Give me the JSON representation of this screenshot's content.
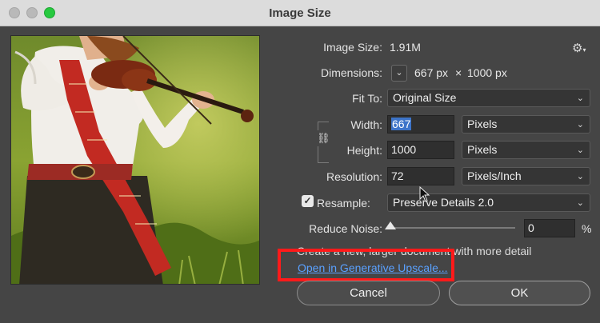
{
  "window": {
    "title": "Image Size"
  },
  "image_size": {
    "label": "Image Size:",
    "value": "1.91M"
  },
  "dimensions": {
    "label": "Dimensions:",
    "width": "667 px",
    "times": "×",
    "height": "1000 px"
  },
  "fit_to": {
    "label": "Fit To:",
    "selected": "Original Size"
  },
  "width": {
    "label": "Width:",
    "value": "667",
    "unit": "Pixels"
  },
  "height": {
    "label": "Height:",
    "value": "1000",
    "unit": "Pixels"
  },
  "resolution": {
    "label": "Resolution:",
    "value": "72",
    "unit": "Pixels/Inch"
  },
  "resample": {
    "label": "Resample:",
    "checked": true,
    "selected": "Preserve Details 2.0"
  },
  "reduce_noise": {
    "label": "Reduce Noise:",
    "value": "0",
    "unit": "%",
    "level": 0
  },
  "generative": {
    "info": "Create a new, larger document with more detail",
    "link": "Open in Generative Upscale..."
  },
  "buttons": {
    "cancel": "Cancel",
    "ok": "OK"
  },
  "icons": {
    "settings": "gear-icon",
    "link": "chain-link-icon",
    "dropdown": "chevron-down-icon"
  },
  "colors": {
    "dialog_bg": "#454545",
    "link": "#5aa1ff",
    "highlight_box": "#ff1a1a",
    "selection": "#3d74c9",
    "traffic_green": "#27c93f"
  }
}
